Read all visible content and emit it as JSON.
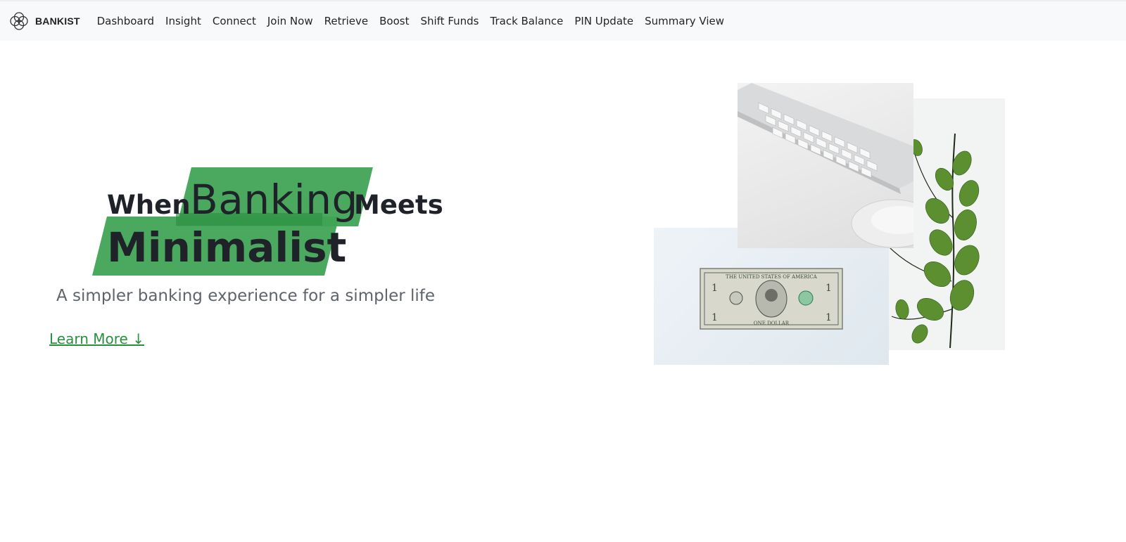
{
  "brand": {
    "name": "BANKIST",
    "logo_icon": "bankist-logo-icon"
  },
  "nav": {
    "items": [
      {
        "label": "Dashboard"
      },
      {
        "label": "Insight"
      },
      {
        "label": "Connect"
      },
      {
        "label": "Join Now"
      },
      {
        "label": "Retrieve"
      },
      {
        "label": "Boost"
      },
      {
        "label": "Shift Funds"
      },
      {
        "label": "Track Balance"
      },
      {
        "label": "PIN Update"
      },
      {
        "label": "Summary View"
      }
    ]
  },
  "hero": {
    "title_word_1": "When",
    "title_highlight_1": "Banking",
    "title_word_2": "Meets",
    "title_highlight_2": "Minimalist",
    "subtitle": "A simpler banking experience for a simpler life",
    "cta": "Learn More ↓"
  },
  "colors": {
    "highlight": "#3fa454",
    "link": "#28913e",
    "navbar_bg": "#f8f9fa"
  }
}
